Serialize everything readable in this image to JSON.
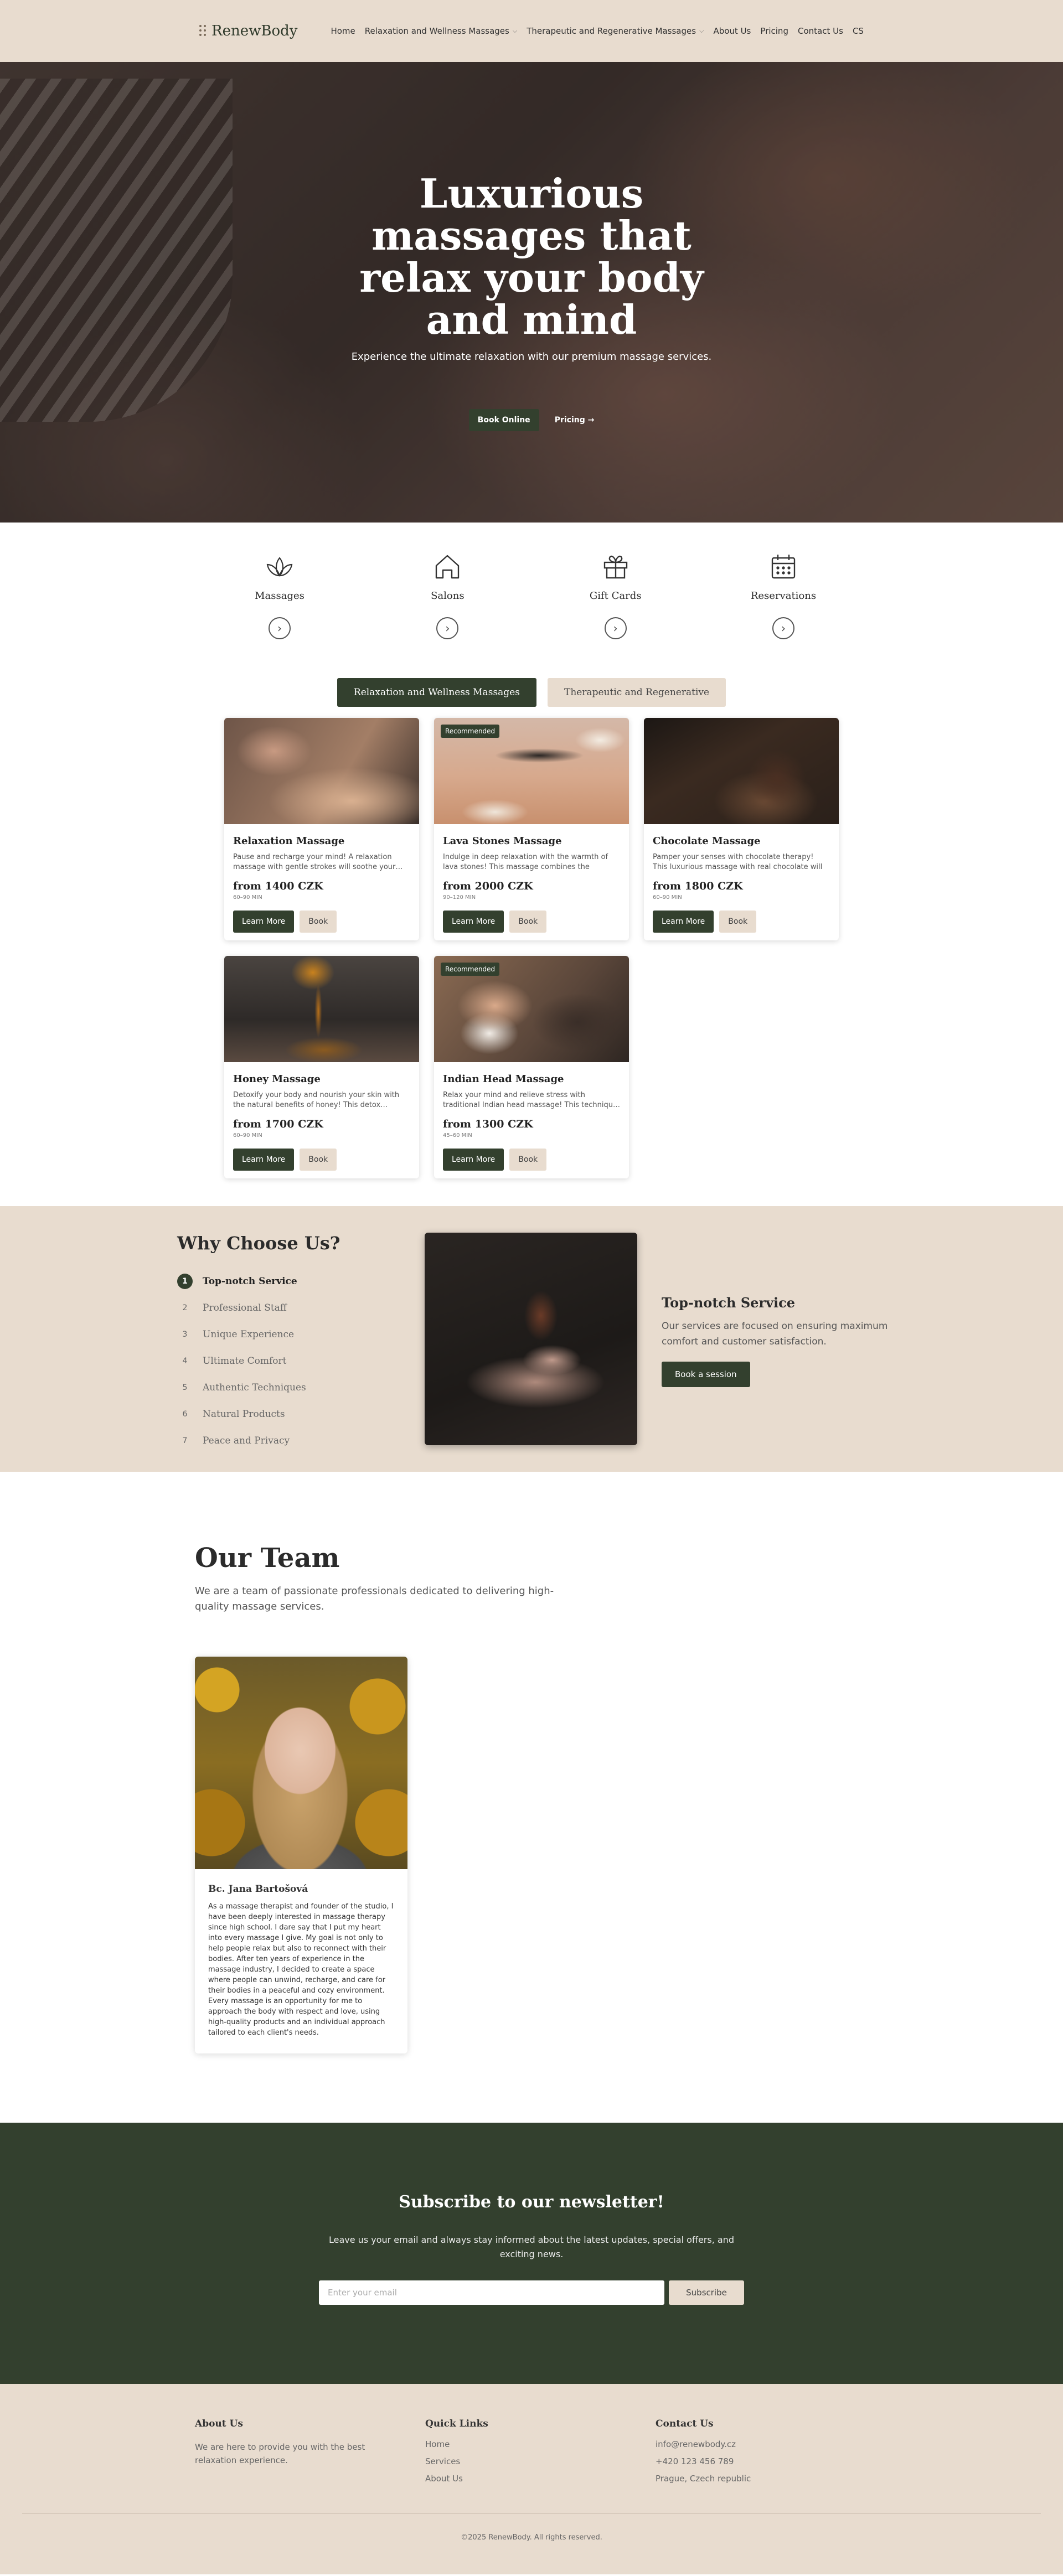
{
  "header": {
    "logo": "RenewBody",
    "nav": [
      {
        "label": "Home",
        "dropdown": false
      },
      {
        "label": "Relaxation and Wellness Massages",
        "dropdown": true
      },
      {
        "label": "Therapeutic and Regenerative Massages",
        "dropdown": true
      },
      {
        "label": "About Us",
        "dropdown": false
      },
      {
        "label": "Pricing",
        "dropdown": false
      },
      {
        "label": "Contact Us",
        "dropdown": false
      },
      {
        "label": "CS",
        "dropdown": false
      }
    ]
  },
  "hero": {
    "title": "Luxurious massages that relax your body and mind",
    "subtitle": "Experience the ultimate relaxation with our premium massage services.",
    "primary_button": "Book Online",
    "secondary_link": "Pricing →"
  },
  "quick_links": [
    {
      "label": "Massages",
      "icon": "lotus-icon"
    },
    {
      "label": "Salons",
      "icon": "home-icon"
    },
    {
      "label": "Gift Cards",
      "icon": "gift-icon"
    },
    {
      "label": "Reservations",
      "icon": "calendar-icon"
    }
  ],
  "tabs": [
    {
      "label": "Relaxation and Wellness Massages",
      "active": true
    },
    {
      "label": "Therapeutic and Regenerative",
      "active": false
    }
  ],
  "cards": [
    {
      "title": "Relaxation Massage",
      "desc": "Pause and recharge your mind! A relaxation massage with gentle strokes will soothe your…",
      "price": "from 1400 CZK",
      "duration": "60–90 MIN",
      "badge": "",
      "learn": "Learn More",
      "book": "Book"
    },
    {
      "title": "Lava Stones Massage",
      "desc": "Indulge in deep relaxation with the warmth of lava stones! This massage combines the healin…",
      "price": "from 2000 CZK",
      "duration": "90–120 MIN",
      "badge": "Recommended",
      "learn": "Learn More",
      "book": "Book"
    },
    {
      "title": "Chocolate Massage",
      "desc": "Pamper your senses with chocolate therapy! This luxurious massage with real chocolate will leav…",
      "price": "from 1800 CZK",
      "duration": "60–90 MIN",
      "badge": "",
      "learn": "Learn More",
      "book": "Book"
    },
    {
      "title": "Honey Massage",
      "desc": "Detoxify your body and nourish your skin with the natural benefits of honey! This detox…",
      "price": "from 1700 CZK",
      "duration": "60–90 MIN",
      "badge": "",
      "learn": "Learn More",
      "book": "Book"
    },
    {
      "title": "Indian Head Massage",
      "desc": "Relax your mind and relieve stress with traditional Indian head massage! This techniqu…",
      "price": "from 1300 CZK",
      "duration": "45–60 MIN",
      "badge": "Recommended",
      "learn": "Learn More",
      "book": "Book"
    }
  ],
  "why": {
    "title": "Why Choose Us?",
    "items": [
      "Top-notch Service",
      "Professional Staff",
      "Unique Experience",
      "Ultimate Comfort",
      "Authentic Techniques",
      "Natural Products",
      "Peace and Privacy"
    ],
    "active_index": 0,
    "detail_title": "Top-notch Service",
    "detail_text": "Our services are focused on ensuring maximum comfort and customer satisfaction.",
    "detail_button": "Book a session"
  },
  "team": {
    "title": "Our Team",
    "text": "We are a team of passionate professionals dedicated to delivering high-quality massage services.",
    "member": {
      "name": "Bc. Jana Bartošová",
      "bio": "As a massage therapist and founder of the studio, I have been deeply interested in massage therapy since high school. I dare say that I put my heart into every massage I give. My goal is not only to help people relax but also to reconnect with their bodies. After ten years of experience in the massage industry, I decided to create a space where people can unwind, recharge, and care for their bodies in a peaceful and cozy environment. Every massage is an opportunity for me to approach the body with respect and love, using high-quality products and an individual approach tailored to each client's needs."
    }
  },
  "newsletter": {
    "title": "Subscribe to our newsletter!",
    "text": "Leave us your email and always stay informed about the latest updates, special offers, and exciting news.",
    "placeholder": "Enter your email",
    "button": "Subscribe"
  },
  "footer": {
    "about_title": "About Us",
    "about_text": "We are here to provide you with the best relaxation experience.",
    "links_title": "Quick Links",
    "links": [
      "Home",
      "Services",
      "About Us"
    ],
    "contact_title": "Contact Us",
    "contact": [
      "info@renewbody.cz",
      "+420 123 456 789",
      "Prague, Czech republic"
    ],
    "copyright": "©2025 RenewBody. All rights reserved."
  },
  "colors": {
    "brand_dark_green": "#33402e",
    "beige": "#e8dccf"
  }
}
